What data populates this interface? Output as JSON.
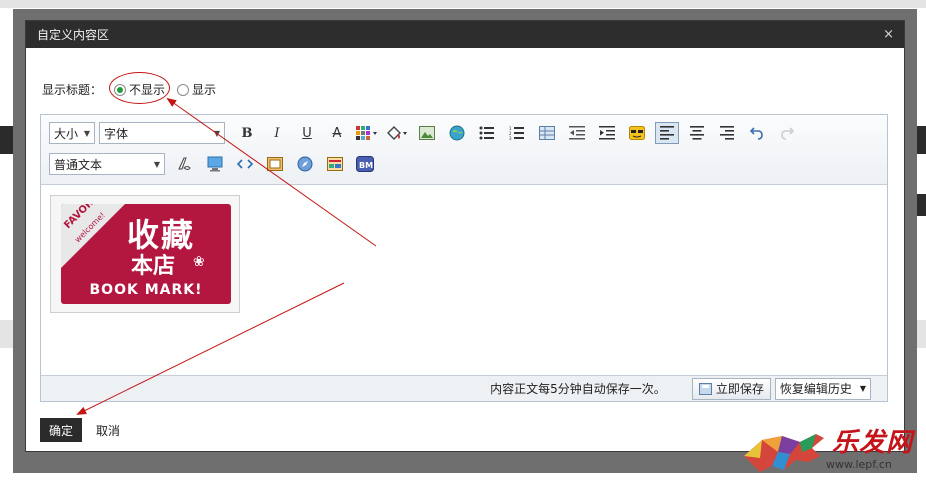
{
  "dialog": {
    "title": "自定义内容区",
    "close_glyph": "×"
  },
  "title_setting": {
    "label": "显示标题：",
    "options": [
      {
        "label": "不显示",
        "checked": true
      },
      {
        "label": "显示",
        "checked": false
      }
    ]
  },
  "toolbar": {
    "size_select": "大小",
    "font_select": "字体",
    "format_select": "普通文本",
    "bold": "B",
    "italic": "I",
    "underline": "U",
    "strike": "A"
  },
  "banner": {
    "line1": "收藏",
    "line2": "本店",
    "corner_top": "FAVORITE",
    "corner_sub": "welcome!",
    "mark": "BOOK MARK!"
  },
  "statusbar": {
    "autosave_text": "内容正文每5分钟自动保存一次。",
    "save_now": "立即保存",
    "history": "恢复编辑历史"
  },
  "actions": {
    "ok": "确定",
    "cancel": "取消"
  },
  "watermark": {
    "brand": "乐发网",
    "url": "www.lepf.cn"
  },
  "colors": {
    "header_bg": "#2d2d2d",
    "annotation": "#c41515",
    "banner_bg": "#b3163f",
    "radio_checked": "#1f9c3a"
  }
}
